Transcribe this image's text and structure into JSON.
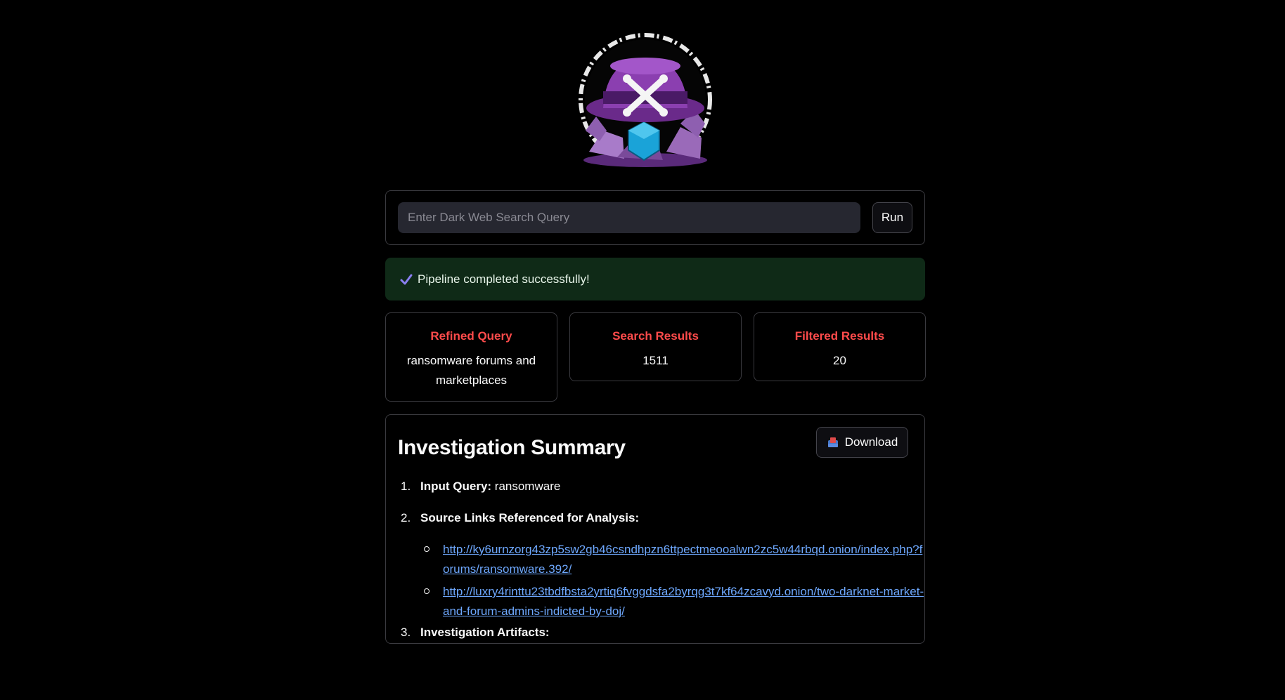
{
  "app": {
    "logo": "logo-hat-skull-crystals"
  },
  "search": {
    "placeholder": "Enter Dark Web Search Query",
    "value": "",
    "run_label": "Run"
  },
  "status": {
    "message": "Pipeline completed successfully!",
    "icon": "check-icon",
    "color": "#0f2a17"
  },
  "metrics": [
    {
      "label": "Refined Query",
      "value": "ransomware forums and marketplaces"
    },
    {
      "label": "Search Results",
      "value": "1511"
    },
    {
      "label": "Filtered Results",
      "value": "20"
    }
  ],
  "summary": {
    "title": "Investigation Summary",
    "download_label": "Download",
    "download_icon": "inbox-tray-icon",
    "items": [
      {
        "number": "1.",
        "label": "Input Query:",
        "value": " ransomware"
      },
      {
        "number": "2.",
        "label": "Source Links Referenced for Analysis:",
        "value": ""
      },
      {
        "number": "3.",
        "label": "Investigation Artifacts:",
        "value": ""
      }
    ],
    "links": [
      "http://ky6urnzorg43zp5sw2gb46csndhpzn6ttpectmeooalwn2zc5w44rbqd.onion/index.php?forums/ransomware.392/",
      "http://luxry4rinttu23tbdfbsta2yrtiq6fvggdsfa2byrqg3t7kf64zcavyd.onion/two-darknet-market-and-forum-admins-indicted-by-doj/"
    ]
  },
  "colors": {
    "background": "#000000",
    "accent_red": "#ff4b4b",
    "link_blue": "#6ea8fe",
    "success_bg": "#0f2a17"
  }
}
